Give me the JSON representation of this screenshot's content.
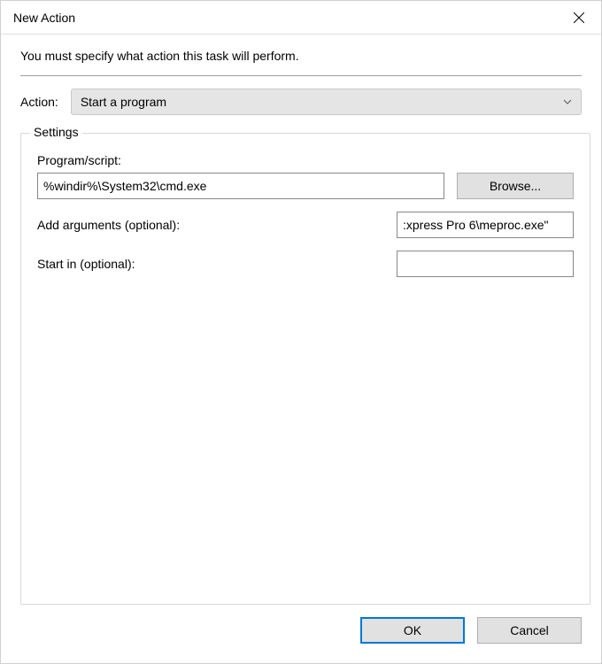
{
  "titlebar": {
    "title": "New Action"
  },
  "instruction": "You must specify what action this task will perform.",
  "action": {
    "label": "Action:",
    "selected": "Start a program"
  },
  "settings": {
    "groupTitle": "Settings",
    "program": {
      "label": "Program/script:",
      "value": "%windir%\\System32\\cmd.exe",
      "browseLabel": "Browse..."
    },
    "arguments": {
      "label": "Add arguments (optional):",
      "value": ":xpress Pro 6\\meproc.exe\""
    },
    "startIn": {
      "label": "Start in (optional):",
      "value": ""
    }
  },
  "buttons": {
    "ok": "OK",
    "cancel": "Cancel"
  }
}
